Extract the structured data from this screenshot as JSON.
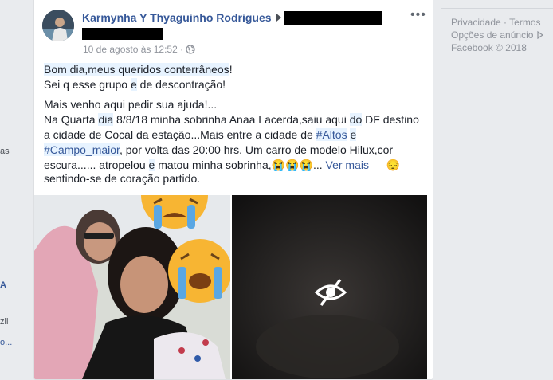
{
  "left_fragments": {
    "text_1": "as",
    "text_2": "zil",
    "text_3": "o..."
  },
  "post": {
    "author": "Karmynha Y Thyaguinho Rodrigues",
    "timestamp": "10 de agosto às 12:52 ·",
    "lines": {
      "l1a": "Bom dia,meus queridos conterrâneos",
      "l1b": "!",
      "l2a": "Sei q esse grupo ",
      "l2b": "e",
      "l2c": " de descontração!",
      "p2_1": "Mais venho aqui pedir sua ajuda!...",
      "p2_2a": "Na Quarta ",
      "p2_2b": "dia",
      "p2_2c": " 8/8/18 minha sobrinha Anaa Lacerda,saiu aqui ",
      "p2_2d": "do",
      "p2_2e": " DF destino",
      "p2_3a": "a cidade de Cocal da estação...Mais entre a cidade de ",
      "p2_3b": "#Altos",
      "p2_3c": " ",
      "p2_3d": "e",
      "p2_4a": "#Campo_maior",
      "p2_4b": ", por volta das 20:00 hrs. Um carro de modelo Hilux,cor",
      "p2_5a": "escura...... atropelou ",
      "p2_5b": "e",
      "p2_5c": " matou minha sobrinha,",
      "p2_5d": "😭😭😭",
      "p2_5e": "... ",
      "see_more": "Ver mais",
      "dash": " — ",
      "feeling_emoji": "😔",
      "feeling": "sentindo-se de coração partido."
    }
  },
  "sidebar": {
    "footer_links": [
      "Privacidade",
      "Termos",
      "Opções de anúncio"
    ],
    "copyright": "Facebook © 2018"
  },
  "colors": {
    "link": "#365899",
    "background": "#e9ebee",
    "hashtag_highlight": "#e7f3ff"
  },
  "icons": {
    "privacy": "globe-icon",
    "more": "more-options-icon",
    "hidden": "eye-slash-icon",
    "ad_choices": "ad-choices-icon"
  }
}
